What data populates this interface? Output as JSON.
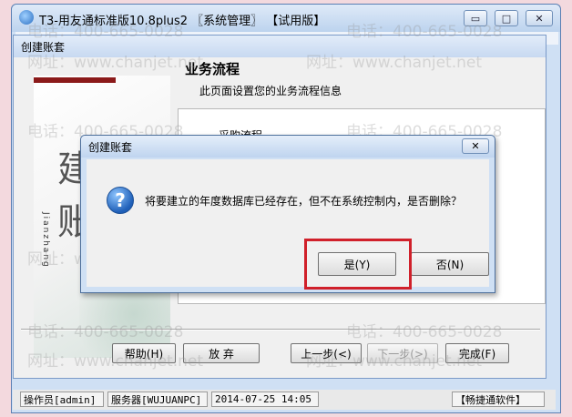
{
  "window": {
    "title": "T3-用友通标准版10.8plus2 〖系统管理〗 【试用版】",
    "minimize_symbol": "▭",
    "maximize_symbol": "□",
    "close_symbol": "✕"
  },
  "wizard": {
    "title": "创建账套",
    "heading": "业务流程",
    "subheading": "此页面设置您的业务流程信息",
    "list_item_partial": "采购流程",
    "side_art": {
      "big_char_1": "建",
      "big_char_2": "账",
      "vertical_text": "Jianzhang"
    },
    "buttons": {
      "help": "帮助(H)",
      "cancel": "放 弃",
      "prev": "上一步(<)",
      "next": "下一步(>)",
      "finish": "完成(F)"
    }
  },
  "dialog": {
    "title": "创建账套",
    "icon": "question-icon",
    "message": "将要建立的年度数据库已经存在，但不在系统控制内，是否删除？",
    "yes": "是(Y)",
    "no": "否(N)",
    "close_symbol": "✕",
    "highlight_color": "#d0202a"
  },
  "statusbar": {
    "operator": "操作员[admin]",
    "server": "服务器[WUJUANPC]",
    "datetime": "2014-07-25 14:05",
    "brand": "【畅捷通软件】"
  },
  "watermark": {
    "phone": "电话：400-665-0028",
    "site": "网址：www.chanjet.net"
  }
}
